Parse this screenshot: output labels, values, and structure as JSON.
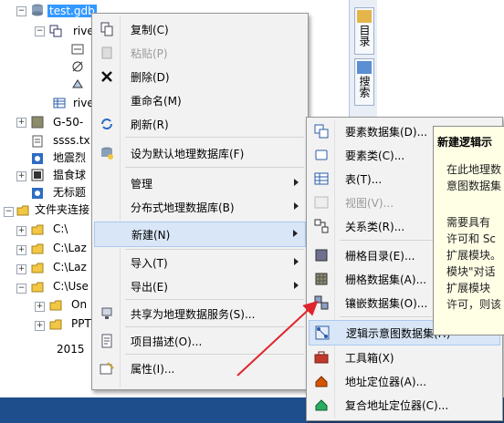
{
  "tree": {
    "items": [
      {
        "label": "test.gdb"
      },
      {
        "label": "rive"
      },
      {
        "label": ""
      },
      {
        "label": ""
      },
      {
        "label": "rive"
      },
      {
        "label": "G-50-"
      },
      {
        "label": "ssss.tx"
      },
      {
        "label": "地震烈"
      },
      {
        "label": "揾食球"
      },
      {
        "label": "无标题"
      },
      {
        "label": "文件夹连接"
      },
      {
        "label": "C:\\"
      },
      {
        "label": "C:\\Laz"
      },
      {
        "label": "C:\\Laz"
      },
      {
        "label": "C:\\Use"
      },
      {
        "label": "On"
      },
      {
        "label": "PPT"
      },
      {
        "label": "2015"
      }
    ]
  },
  "dock": {
    "catalog": "目录",
    "search": "搜索"
  },
  "context_menu": {
    "items": [
      {
        "label": "复制(C)",
        "icon": "copy-icon"
      },
      {
        "label": "粘贴(P)",
        "icon": "paste-icon",
        "disabled": true
      },
      {
        "label": "删除(D)",
        "icon": "delete-icon"
      },
      {
        "label": "重命名(M)"
      },
      {
        "label": "刷新(R)",
        "icon": "refresh-icon"
      },
      {
        "label": "设为默认地理数据库(F)",
        "icon": "default-gdb-icon"
      },
      {
        "label": "管理"
      },
      {
        "label": "分布式地理数据库(B)"
      },
      {
        "label": "新建(N)"
      },
      {
        "label": "导入(T)"
      },
      {
        "label": "导出(E)"
      },
      {
        "label": "共享为地理数据服务(S)...",
        "icon": "share-icon"
      },
      {
        "label": "项目描述(O)...",
        "icon": "description-icon"
      },
      {
        "label": "属性(I)...",
        "icon": "properties-icon"
      }
    ]
  },
  "submenu": {
    "items": [
      {
        "label": "要素数据集(D)...",
        "icon": "feature-dataset-icon"
      },
      {
        "label": "要素类(C)...",
        "icon": "feature-class-icon"
      },
      {
        "label": "表(T)...",
        "icon": "table-icon"
      },
      {
        "label": "视图(V)...",
        "icon": "view-icon",
        "disabled": true
      },
      {
        "label": "关系类(R)...",
        "icon": "relationship-class-icon"
      },
      {
        "label": "栅格目录(E)...",
        "icon": "raster-catalog-icon"
      },
      {
        "label": "栅格数据集(A)...",
        "icon": "raster-dataset-icon"
      },
      {
        "label": "镶嵌数据集(O)...",
        "icon": "mosaic-dataset-icon"
      },
      {
        "label": "逻辑示意图数据集(H)",
        "icon": "schematic-dataset-icon"
      },
      {
        "label": "工具箱(X)",
        "icon": "toolbox-icon"
      },
      {
        "label": "地址定位器(A)...",
        "icon": "address-locator-icon"
      },
      {
        "label": "复合地址定位器(C)...",
        "icon": "composite-locator-icon"
      }
    ]
  },
  "tooltip": {
    "title": "新建逻辑示",
    "lines": [
      "在此地理数",
      "意图数据集",
      "",
      "需要具有",
      "许可和 Sc",
      "扩展模块。",
      "模块\"对话",
      "扩展模块",
      "许可，则该"
    ]
  },
  "colors": {
    "selection": "#3399ff",
    "highlight": "#d8e6f7",
    "arrow": "#e0242c",
    "taskbar": "#1f4e8c"
  }
}
